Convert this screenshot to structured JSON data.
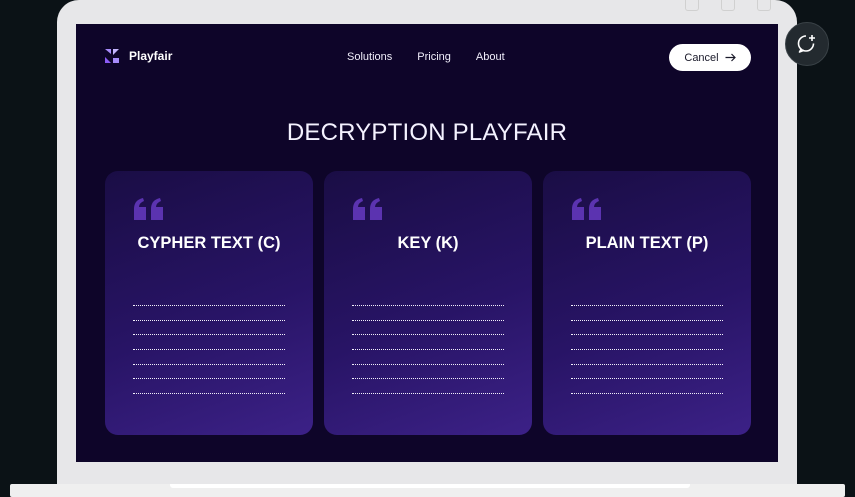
{
  "app": {
    "brand": "Playfair"
  },
  "nav": {
    "items": [
      {
        "label": "Solutions"
      },
      {
        "label": "Pricing"
      },
      {
        "label": "About"
      }
    ],
    "cancel_label": "Cancel"
  },
  "page": {
    "title": "DECRYPTION PLAYFAIR"
  },
  "cards": [
    {
      "title": "CYPHER TEXT (C)",
      "icon": "quote-icon"
    },
    {
      "title": "KEY (K)",
      "icon": "quote-icon"
    },
    {
      "title": "PLAIN TEXT (P)",
      "icon": "quote-icon"
    }
  ],
  "colors": {
    "background": "#0e0529",
    "card_gradient_start": "#1a0d45",
    "card_gradient_end": "#3c2187",
    "accent": "#6a3fc7"
  }
}
